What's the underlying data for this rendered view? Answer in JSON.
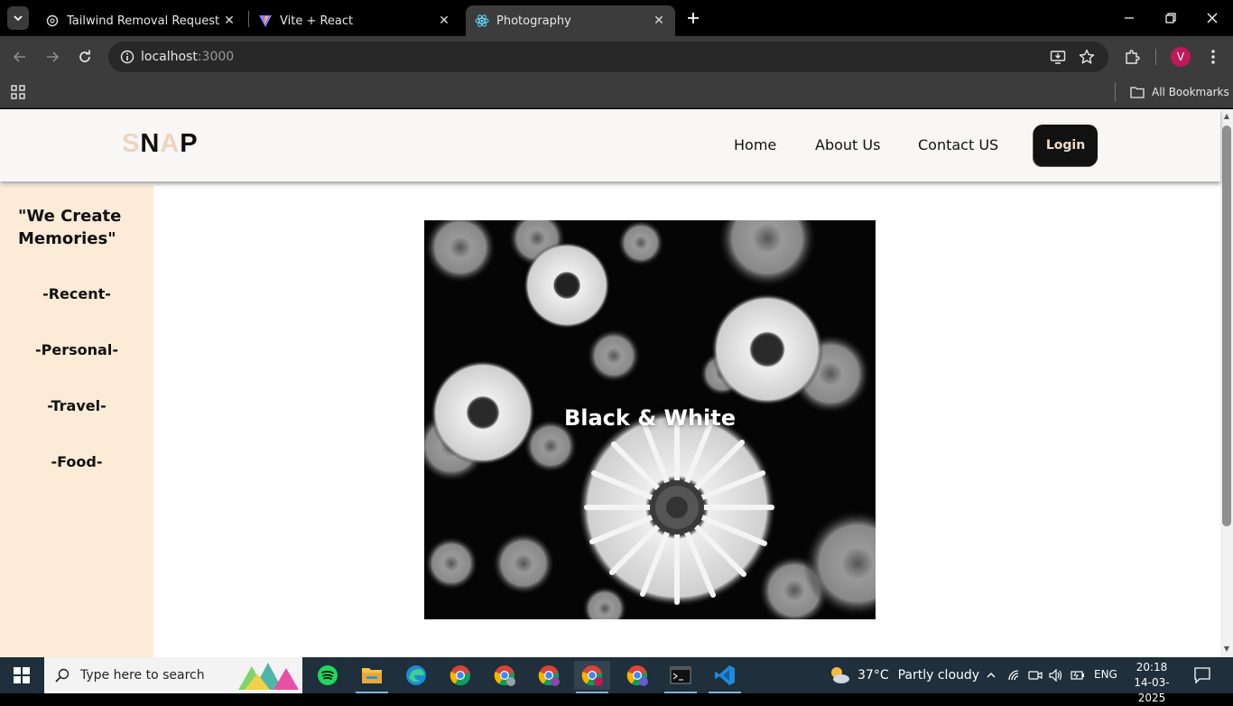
{
  "browser": {
    "tabs": [
      {
        "title": "Tailwind Removal Request",
        "icon": "chatgpt-icon",
        "active": false
      },
      {
        "title": "Vite + React",
        "icon": "vite-icon",
        "active": false
      },
      {
        "title": "Photography",
        "icon": "react-icon",
        "active": true
      }
    ],
    "url_host": "localhost",
    "url_port": ":3000",
    "bookmarks_label": "All Bookmarks",
    "profile_initial": "V"
  },
  "site": {
    "logo_letters": [
      "S",
      "N",
      "A",
      "P"
    ],
    "nav": {
      "home": "Home",
      "about": "About Us",
      "contact": "Contact US",
      "login": "Login"
    },
    "sidebar": {
      "quote": "\"We Create Memories\"",
      "items": [
        "-Recent-",
        "-Personal-",
        "-Travel-",
        "-Food-"
      ]
    },
    "photo": {
      "caption": "Black & White",
      "subject": "black and white daisy flowers"
    }
  },
  "taskbar": {
    "search_placeholder": "Type here to search",
    "weather_temp": "37°C",
    "weather_cond": "Partly cloudy",
    "language": "ENG",
    "time": "20:18",
    "date": "14-03-2025"
  },
  "colors": {
    "logo_light": "#ecd5bf",
    "sidebar_bg": "#fbebd7",
    "login_bg": "#111111",
    "login_text": "#f0dcc8"
  }
}
